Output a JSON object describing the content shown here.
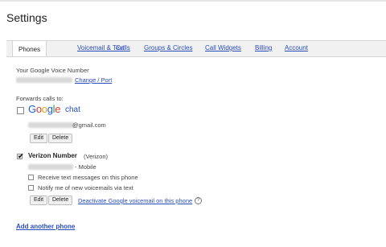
{
  "page": {
    "title": "Settings"
  },
  "tabs": [
    {
      "label": "Phones"
    },
    {
      "label": "Voicemail & Text"
    },
    {
      "label": "Calls"
    },
    {
      "label": "Groups & Circles"
    },
    {
      "label": "Call Widgets"
    },
    {
      "label": "Billing"
    },
    {
      "label": "Account"
    }
  ],
  "google_voice": {
    "label": "Your Google Voice Number",
    "change_port_link": "Change / Port"
  },
  "forwards": {
    "label": "Forwards calls to:",
    "google_chat": {
      "brand_letters": [
        "G",
        "o",
        "o",
        "g",
        "l",
        "e"
      ],
      "brand_colors": [
        "#1a5fd6",
        "#d63b2a",
        "#e3a51a",
        "#1a5fd6",
        "#2c9b3a",
        "#d63b2a"
      ],
      "chat_word": "chat",
      "email_suffix": "@gmail.com",
      "checked": false,
      "edit_label": "Edit",
      "delete_label": "Delete"
    },
    "verizon": {
      "name": "Verizon Number",
      "carrier": "(Verizon)",
      "type": "- Mobile",
      "checked": true,
      "options": [
        {
          "label": "Receive text messages on this phone",
          "checked": false
        },
        {
          "label": "Notify me of new voicemails via text",
          "checked": false
        }
      ],
      "edit_label": "Edit",
      "delete_label": "Delete",
      "deactivate_link": "Deactivate Google voicemail on this phone",
      "help_icon": "?"
    }
  },
  "add_phone_link": "Add another phone"
}
